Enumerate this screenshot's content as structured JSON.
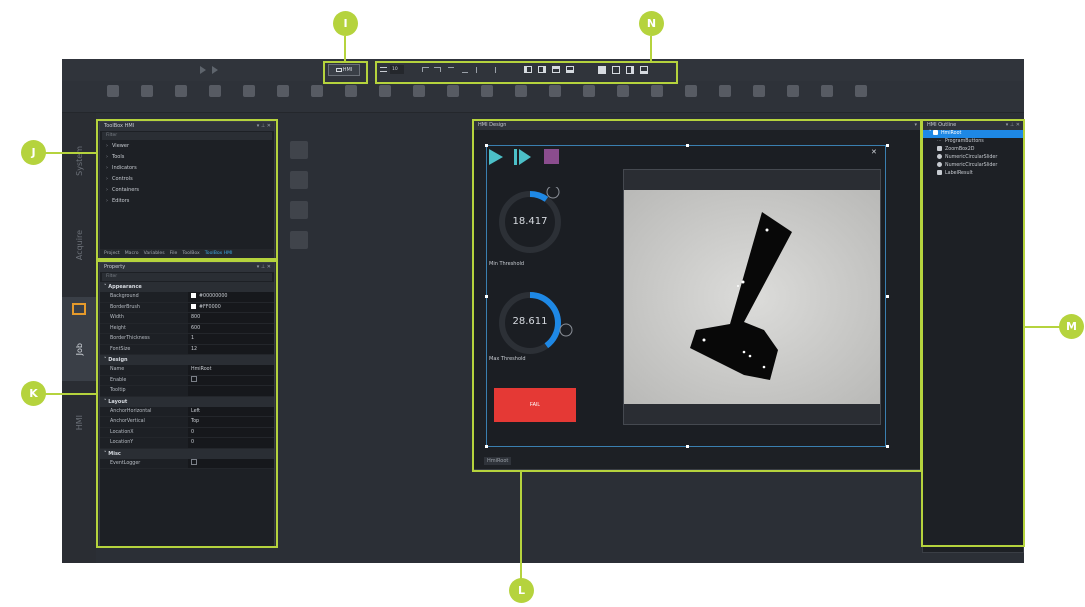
{
  "callouts": {
    "i": "I",
    "n": "N",
    "j": "J",
    "k": "K",
    "l": "L",
    "m": "M"
  },
  "toolbar": {
    "hmi_button_label": "HMI",
    "font_size_value": "10"
  },
  "rail": {
    "items": [
      "System",
      "Acquire",
      "Job",
      "HMI"
    ]
  },
  "toolbox": {
    "title": "ToolBox HMI",
    "filter_placeholder": "Filter",
    "items": [
      "Viewer",
      "Tools",
      "Indicators",
      "Controls",
      "Containers",
      "Editors"
    ],
    "tabs": [
      "Project",
      "Macro",
      "Variables",
      "File",
      "ToolBox",
      "ToolBox HMI"
    ]
  },
  "property": {
    "title": "Property",
    "filter_placeholder": "Filter",
    "groups": {
      "appearance": "Appearance",
      "design": "Design",
      "layout": "Layout",
      "misc": "Misc"
    },
    "rows": {
      "background": {
        "k": "Background",
        "v": "#00000000"
      },
      "borderbrush": {
        "k": "BorderBrush",
        "v": "#FF0000"
      },
      "width": {
        "k": "Width",
        "v": "800"
      },
      "height": {
        "k": "Height",
        "v": "600"
      },
      "borderthickness": {
        "k": "BorderThickness",
        "v": "1"
      },
      "fontsize": {
        "k": "FontSize",
        "v": "12"
      },
      "name": {
        "k": "Name",
        "v": "HmiRoot"
      },
      "enable": {
        "k": "Enable",
        "v": ""
      },
      "tooltip": {
        "k": "Tooltip",
        "v": ""
      },
      "anchorh": {
        "k": "AnchorHorizontal",
        "v": "Left"
      },
      "anchorv": {
        "k": "AnchorVertical",
        "v": "Top"
      },
      "locx": {
        "k": "LocationX",
        "v": "0"
      },
      "locy": {
        "k": "LocationY",
        "v": "0"
      },
      "eventlogger": {
        "k": "EventLogger",
        "v": ""
      }
    }
  },
  "hmi_design": {
    "title": "HMI Design",
    "gauge_min_value": "18.417",
    "gauge_min_label": "Min Threshold",
    "gauge_max_value": "28.611",
    "gauge_max_label": "Max Threshold",
    "fail_label": "FAIL",
    "root_tag": "HmiRoot",
    "gauge_min_fraction": 0.1,
    "gauge_max_fraction": 0.4
  },
  "outline": {
    "title": "HMI Outline",
    "root": "HmiRoot",
    "items": [
      "ProgramButtons",
      "ZoomBox2D",
      "NumericCircularSlider",
      "NumericCircularSlider",
      "LabelResult"
    ]
  },
  "colors": {
    "accent": "#b5d33d",
    "selection": "#1e88e5",
    "fail": "#e53935",
    "gauge": "#1e88e5"
  }
}
